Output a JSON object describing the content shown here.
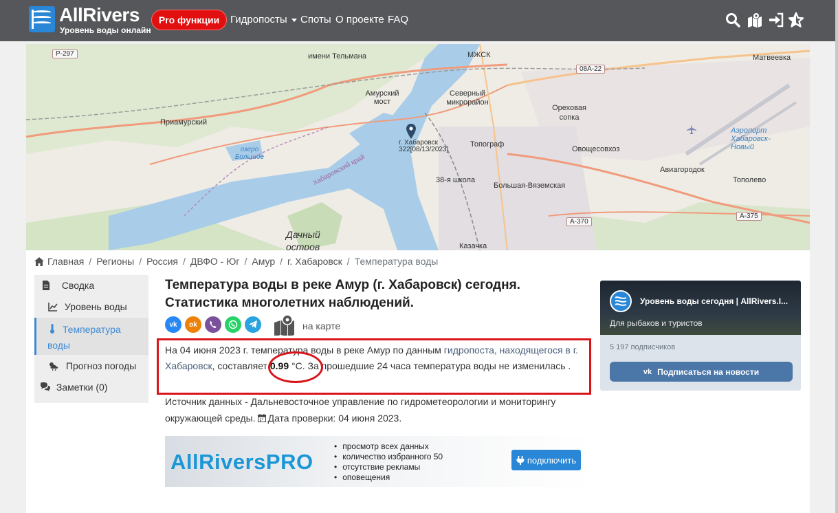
{
  "brand": {
    "name": "AllRivers",
    "tagline": "Уровень воды онлайн",
    "accent": "#2a86d6"
  },
  "nav": {
    "pro_label": "Pro функции",
    "items": [
      {
        "label": "Гидропосты",
        "has_dropdown": true
      },
      {
        "label": "Споты"
      },
      {
        "label": "О проекте"
      },
      {
        "label": "FAQ"
      }
    ],
    "icons": [
      "search-icon",
      "map-marked-icon",
      "sign-in-icon",
      "star-icon"
    ]
  },
  "map": {
    "labels": [
      "имени Тельмана",
      "МЖСК",
      "Матвеевка",
      "Амурский мост",
      "Северный микрорайон",
      "Ореховая сопка",
      "Приамурский",
      "Аэропорт Хабаровск-Новый",
      "озеро Большое",
      "Хабаровский край",
      "Топограф",
      "Овощесовхоз",
      "Авиагородок",
      "38-я школа",
      "Тополево",
      "Большая-Вяземская",
      "Дачный остров",
      "Казачка"
    ],
    "roads": [
      "Р-297",
      "08А-22",
      "А-370",
      "А-375"
    ],
    "marker_label": "г. Хабаровск",
    "marker_value": "322[08/13/2023]"
  },
  "breadcrumb": [
    {
      "label": "Главная",
      "icon": "home-icon"
    },
    {
      "label": "Регионы"
    },
    {
      "label": "Россия"
    },
    {
      "label": "ДВФО - Юг"
    },
    {
      "label": "Амур"
    },
    {
      "label": "г. Хабаровск"
    },
    {
      "label": "Температура воды",
      "active": true
    }
  ],
  "sidebar": {
    "items": [
      {
        "label": "Сводка",
        "icon": "file-icon"
      },
      {
        "label": "Уровень воды",
        "icon": "chart-line-icon"
      },
      {
        "label": "Температура воды",
        "icon": "thermometer-icon",
        "active": true
      },
      {
        "label": "Прогноз погоды",
        "icon": "cloud-sun-rain-icon"
      },
      {
        "label": "Заметки (0)",
        "icon": "comments-icon"
      }
    ]
  },
  "main": {
    "title": "Температура воды в реке Амур (г. Хабаровск) сегодня. Статистика многолетних наблюдений.",
    "share": [
      "vk-icon",
      "odnoklassniki-icon",
      "viber-icon",
      "whatsapp-icon",
      "telegram-icon"
    ],
    "map_link": "на карте",
    "para_1": "На 04 июня 2023 г. температура воды в реке Амур по данным ",
    "para_link": "гидропоста, находящегося в г. Хабаровск",
    "para_2": ", составляет ",
    "temperature": "0.99",
    "unit": "°C",
    "para_3": ". За прошедшие 24 часа температура воды не изменилась .",
    "source_text": "Источник данных - Дальневосточное управление по гидрометеорологии и мониторингу окружающей среды.",
    "check_label": "Дата проверки: 04 июня 2023."
  },
  "pro_banner": {
    "title": "AllRiversPRO",
    "features": [
      "просмотр всех данных",
      "количество избранного 50",
      "отсутствие рекламы",
      "оповещения"
    ],
    "connect_label": "подключить"
  },
  "vk_widget": {
    "name": "Уровень воды сегодня | AllRivers.I...",
    "desc": "Для рыбаков и туристов",
    "subscribers": "5 197 подписчиков",
    "button": "Подписаться на новости"
  },
  "colors": {
    "navbar": "#55575a",
    "pro_red": "#e10f0f",
    "highlight_red": "#d9141a",
    "vk_blue": "#4a76a8"
  }
}
